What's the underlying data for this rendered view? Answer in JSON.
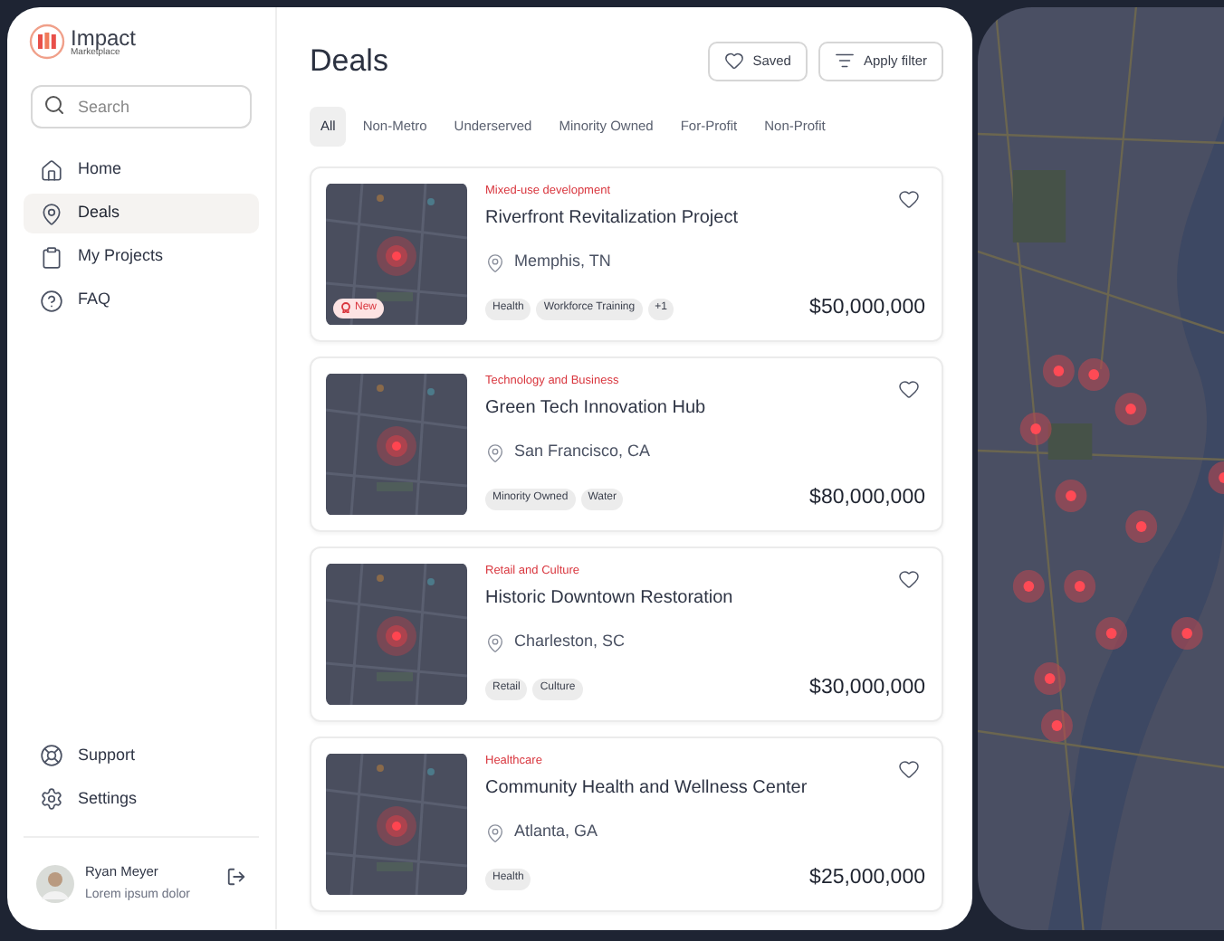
{
  "brand": {
    "name": "Impact",
    "tagline": "Marketplace"
  },
  "search": {
    "placeholder": "Search"
  },
  "nav": [
    {
      "label": "Home",
      "selected": false
    },
    {
      "label": "Deals",
      "selected": true
    },
    {
      "label": "My Projects",
      "selected": false
    },
    {
      "label": "FAQ",
      "selected": false
    }
  ],
  "footer_nav": [
    {
      "label": "Support"
    },
    {
      "label": "Settings"
    }
  ],
  "user": {
    "name": "Ryan Meyer",
    "subtitle": "Lorem ipsum dolor"
  },
  "page_title": "Deals",
  "actions": [
    {
      "label": "Saved"
    },
    {
      "label": "Apply filter"
    }
  ],
  "filters": [
    {
      "label": "All",
      "selected": true
    },
    {
      "label": "Non-Metro",
      "selected": false
    },
    {
      "label": "Underserved",
      "selected": false
    },
    {
      "label": "Minority Owned",
      "selected": false
    },
    {
      "label": "For-Profit",
      "selected": false
    },
    {
      "label": "Non-Profit",
      "selected": false
    }
  ],
  "deals": [
    {
      "category": "Mixed-use development",
      "title": "Riverfront Revitalization Project",
      "location": "Memphis, TN",
      "tags": [
        "Health",
        "Workforce Training",
        "+1"
      ],
      "amount": "$50,000,000",
      "badge": "New"
    },
    {
      "category": "Technology and Business",
      "title": "Green Tech Innovation Hub",
      "location": "San Francisco, CA",
      "tags": [
        "Minority Owned",
        "Water"
      ],
      "amount": "$80,000,000"
    },
    {
      "category": "Retail and Culture",
      "title": "Historic Downtown Restoration",
      "location": "Charleston, SC",
      "tags": [
        "Retail",
        "Culture"
      ],
      "amount": "$30,000,000"
    },
    {
      "category": "Healthcare",
      "title": "Community Health and Wellness Center",
      "location": "Atlanta, GA",
      "tags": [
        "Health"
      ],
      "amount": "$25,000,000"
    }
  ]
}
